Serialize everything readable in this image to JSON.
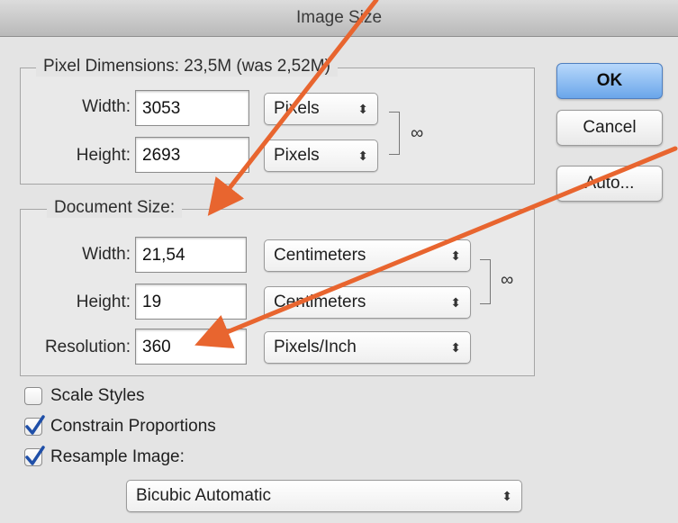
{
  "window": {
    "title": "Image Size"
  },
  "pixel_dimensions": {
    "legend": "Pixel Dimensions:  23,5M (was 2,52M)",
    "width": {
      "label": "Width:",
      "value": "3053",
      "unit": "Pixels"
    },
    "height": {
      "label": "Height:",
      "value": "2693",
      "unit": "Pixels"
    }
  },
  "document_size": {
    "legend": "Document Size:",
    "width": {
      "label": "Width:",
      "value": "21,54",
      "unit": "Centimeters"
    },
    "height": {
      "label": "Height:",
      "value": "19",
      "unit": "Centimeters"
    },
    "resolution": {
      "label": "Resolution:",
      "value": "360",
      "unit": "Pixels/Inch"
    }
  },
  "buttons": {
    "ok": "OK",
    "cancel": "Cancel",
    "auto": "Auto..."
  },
  "options": {
    "scale_styles": {
      "label": "Scale Styles",
      "checked": false
    },
    "constrain_proportions": {
      "label": "Constrain Proportions",
      "checked": true
    },
    "resample_image": {
      "label": "Resample Image:",
      "checked": true
    },
    "resample_method": "Bicubic Automatic"
  },
  "icons": {
    "link": "chain-link-icon",
    "select_arrows": "up-down-arrows-icon",
    "checkmark": "checkmark-icon"
  },
  "colors": {
    "accent_button": "#6aa6ea",
    "annotation_arrow": "#e8652f",
    "checkmark": "#1f4fa8"
  }
}
